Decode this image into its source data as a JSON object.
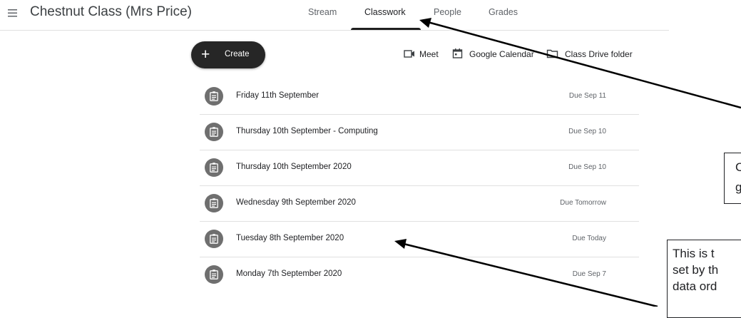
{
  "header": {
    "class_name": "Chestnut Class (Mrs Price)",
    "tabs": [
      {
        "label": "Stream",
        "active": false
      },
      {
        "label": "Classwork",
        "active": true
      },
      {
        "label": "People",
        "active": false
      },
      {
        "label": "Grades",
        "active": false
      }
    ]
  },
  "toolbar": {
    "create_label": "Create",
    "meet_label": "Meet",
    "calendar_label": "Google Calendar",
    "drive_label": "Class Drive folder"
  },
  "assignments": [
    {
      "title": "Friday 11th September",
      "due": "Due Sep 11"
    },
    {
      "title": "Thursday 10th September - Computing",
      "due": "Due Sep 10"
    },
    {
      "title": "Thursday 10th September 2020",
      "due": "Due Sep 10"
    },
    {
      "title": "Wednesday 9th September 2020",
      "due": "Due Tomorrow"
    },
    {
      "title": "Tuesday 8th September 2020",
      "due": "Due Today"
    },
    {
      "title": "Monday 7th September 2020",
      "due": "Due Sep 7"
    }
  ],
  "annotations": {
    "callout_1": {
      "lines": [
        "C",
        "g"
      ]
    },
    "callout_2": {
      "lines": [
        "This is t",
        "set by th",
        "data ord"
      ]
    }
  },
  "colors": {
    "accent": "#1f1f1f",
    "icon_bg": "#6f6f6f",
    "divider": "#e0e0e0"
  }
}
